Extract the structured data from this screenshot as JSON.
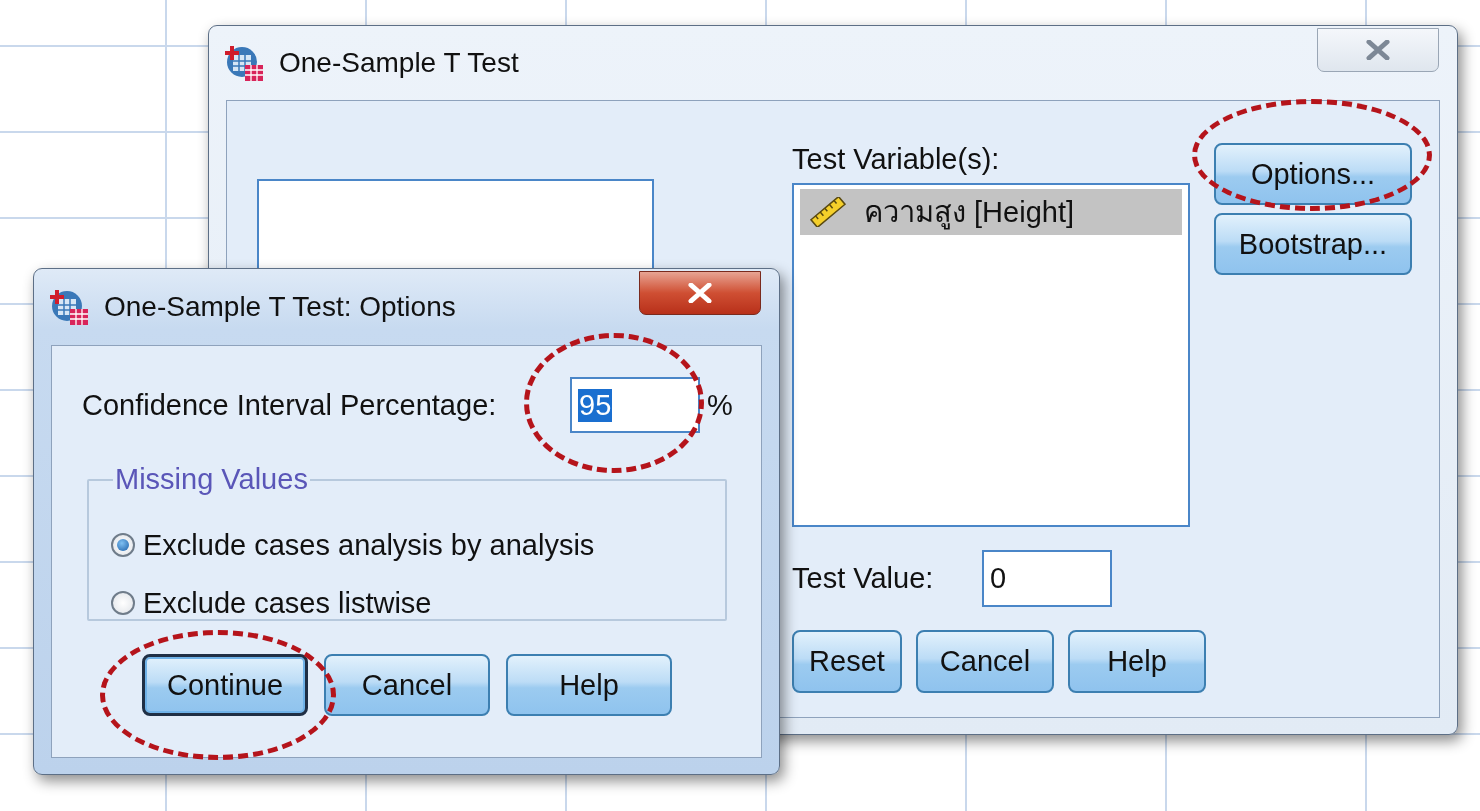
{
  "main_dialog": {
    "title": "One-Sample T Test",
    "active": false,
    "test_variables": {
      "label": "Test Variable(s):",
      "items": [
        {
          "name": "ความสูง [Height]",
          "kind": "scale",
          "selected": true
        }
      ]
    },
    "side_buttons": [
      {
        "label": "Options...",
        "highlight": true
      },
      {
        "label": "Bootstrap...",
        "highlight": false
      }
    ],
    "test_value": {
      "label": "Test Value:",
      "value": "0"
    },
    "buttons": [
      {
        "label": "Reset"
      },
      {
        "label": "Cancel"
      },
      {
        "label": "Help"
      }
    ]
  },
  "options_dialog": {
    "title": "One-Sample T Test: Options",
    "active": true,
    "confidence": {
      "label": "Confidence Interval Percentage:",
      "value": "95",
      "value_selected": true,
      "unit": "%",
      "highlight": true
    },
    "missing_values": {
      "title": "Missing Values",
      "options": [
        {
          "label": "Exclude cases analysis by analysis",
          "selected": true
        },
        {
          "label": "Exclude cases listwise",
          "selected": false
        }
      ]
    },
    "buttons": [
      {
        "label": "Continue",
        "focused": true,
        "highlight": true
      },
      {
        "label": "Cancel",
        "focused": false,
        "highlight": false
      },
      {
        "label": "Help",
        "focused": false,
        "highlight": false
      }
    ]
  }
}
